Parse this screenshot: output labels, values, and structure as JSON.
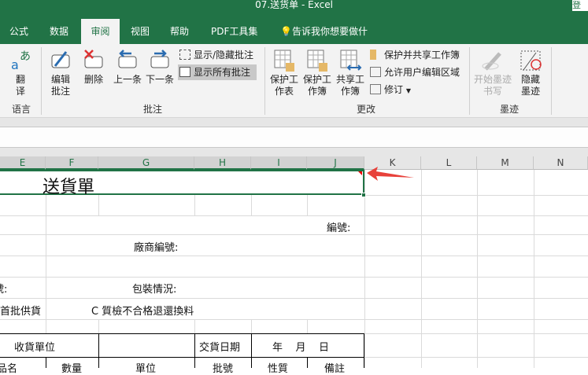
{
  "window": {
    "title": "07.送货单  -  Excel",
    "login": "登"
  },
  "tabs": [
    {
      "label": "公式"
    },
    {
      "label": "数据"
    },
    {
      "label": "审阅"
    },
    {
      "label": "视图"
    },
    {
      "label": "帮助"
    },
    {
      "label": "PDF工具集"
    },
    {
      "label": "告诉我你想要做什"
    }
  ],
  "ribbon": {
    "translate": "翻\n译",
    "lang_group": "语言",
    "edit_comment": "编辑批注",
    "delete": "删除",
    "prev": "上一条",
    "next": "下一条",
    "show_hide": "显示/隐藏批注",
    "show_all": "显示所有批注",
    "comments_group": "批注",
    "protect_sheet": "保护工作表",
    "protect_wb": "保护工作簿",
    "share_wb": "共享工作簿",
    "protect_share": "保护并共享工作簿",
    "allow_edit": "允许用户编辑区域",
    "track": "修订",
    "changes_group": "更改",
    "start_ink": "开始墨迹书写",
    "hide_ink": "隐藏墨迹",
    "ink_group": "墨迹"
  },
  "columns": [
    "E",
    "F",
    "G",
    "H",
    "I",
    "J",
    "K",
    "L",
    "M",
    "N"
  ],
  "cells": {
    "title": "送貨單",
    "number": "編號:",
    "vendor_no": "廠商編號:",
    "left1": "號:",
    "packing": "包裝情況:",
    "opt_b": "首批供貨",
    "opt_c": "C  質檢不合格退還換料",
    "recv_unit": "收貨單位",
    "deliv_date": "交貨日期",
    "ymd": "年    月    日",
    "h_name": "品名",
    "h_qty": "數量",
    "h_unit": "單位",
    "h_batch": "批號",
    "h_nature": "性質",
    "h_note": "備註"
  },
  "colors": {
    "brand": "#217346",
    "arrow": "#e8413a"
  }
}
